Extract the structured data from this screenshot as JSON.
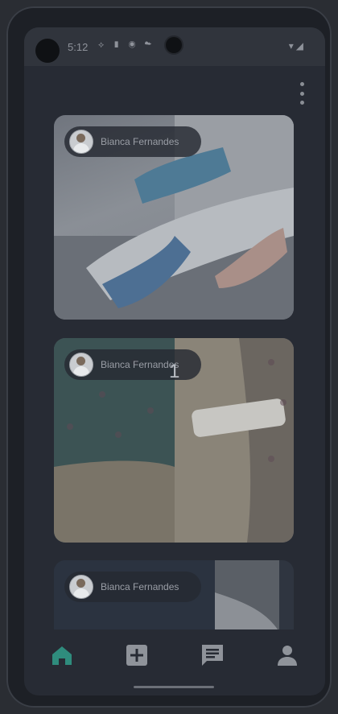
{
  "status": {
    "time": "5:12",
    "left_icons": "⟡ ▮ ◉ ☁",
    "right_icons": "▾◢"
  },
  "posts": [
    {
      "author": "Bianca Fernandes"
    },
    {
      "author": "Bianca Fernandes"
    },
    {
      "author": "Bianca Fernandes"
    }
  ],
  "overlay_badge": "1",
  "nav": {
    "items": [
      {
        "name": "home",
        "active": true
      },
      {
        "name": "add"
      },
      {
        "name": "chat"
      },
      {
        "name": "profile"
      }
    ],
    "accent": "#2f8c7d",
    "inactive": "#8f939a"
  }
}
